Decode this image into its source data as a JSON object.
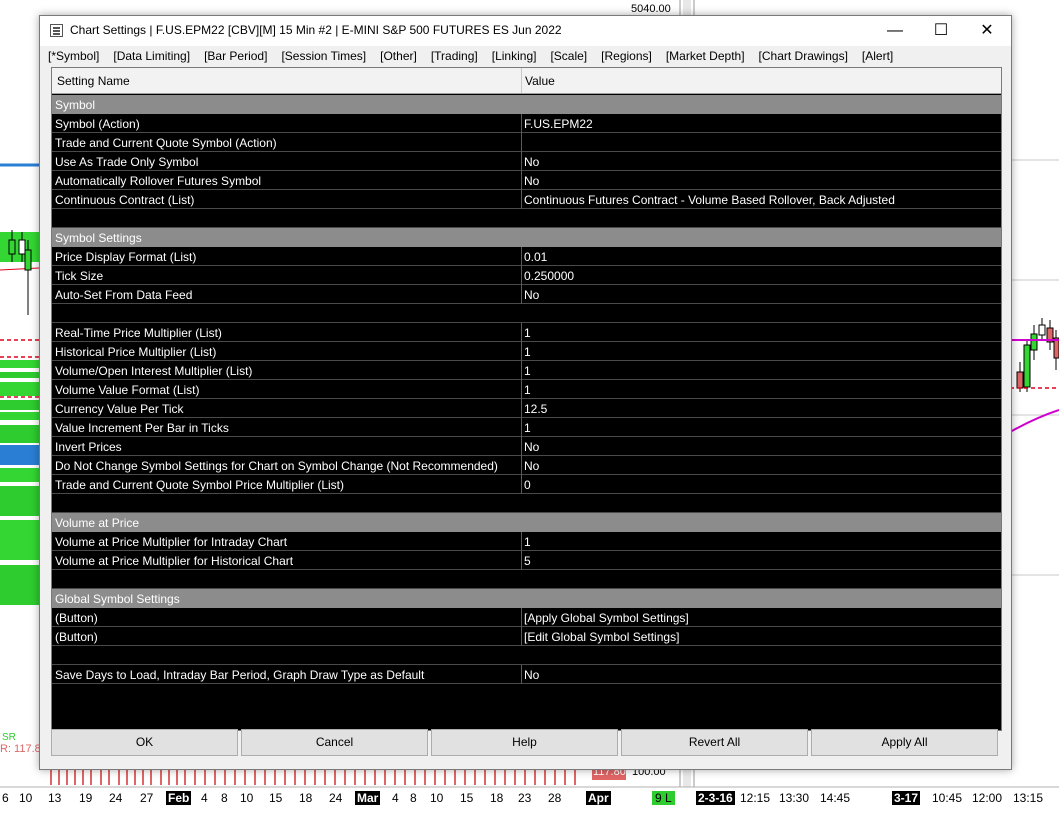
{
  "background": {
    "price_top": "5040.00",
    "price_bottom": "100.00",
    "price_red_tag": "117.80",
    "left_labels": [
      "SR",
      "R: 117.8"
    ],
    "timeline": [
      {
        "text": "6",
        "hl": false
      },
      {
        "text": "10",
        "hl": false
      },
      {
        "text": "13",
        "hl": false
      },
      {
        "text": "19",
        "hl": false
      },
      {
        "text": "24",
        "hl": false
      },
      {
        "text": "27",
        "hl": false
      },
      {
        "text": "Feb",
        "hl": true
      },
      {
        "text": "4",
        "hl": false
      },
      {
        "text": "8",
        "hl": false
      },
      {
        "text": "10",
        "hl": false
      },
      {
        "text": "15",
        "hl": false
      },
      {
        "text": "18",
        "hl": false
      },
      {
        "text": "24",
        "hl": false
      },
      {
        "text": "Mar",
        "hl": true
      },
      {
        "text": "4",
        "hl": false
      },
      {
        "text": "8",
        "hl": false
      },
      {
        "text": "10",
        "hl": false
      },
      {
        "text": "15",
        "hl": false
      },
      {
        "text": "18",
        "hl": false
      },
      {
        "text": "23",
        "hl": false
      },
      {
        "text": "28",
        "hl": false
      },
      {
        "text": "Apr",
        "hl": true
      },
      {
        "text": "9 L",
        "hl": "grn"
      },
      {
        "text": "2-3-16",
        "hl": true
      },
      {
        "text": "12:15",
        "hl": false
      },
      {
        "text": "13:30",
        "hl": false
      },
      {
        "text": "14:45",
        "hl": false
      },
      {
        "text": "3-17",
        "hl": true
      },
      {
        "text": "10:45",
        "hl": false
      },
      {
        "text": "12:00",
        "hl": false
      },
      {
        "text": "13:15",
        "hl": false
      }
    ],
    "colors": {
      "green_bar": "#33d633",
      "red_line": "#e0001b",
      "magenta": "#d000d0",
      "blue": "#2a7fd4"
    }
  },
  "window": {
    "title": "Chart Settings | F.US.EPM22 [CBV][M]  15 Min   #2 | E-MINI S&P 500 FUTURES ES Jun 2022",
    "minimize_icon": "—",
    "maximize_icon": "☐",
    "close_icon": "✕"
  },
  "menu": [
    "[*Symbol]",
    "[Data Limiting]",
    "[Bar Period]",
    "[Session Times]",
    "[Other]",
    "[Trading]",
    "[Linking]",
    "[Scale]",
    "[Regions]",
    "[Market Depth]",
    "[Chart Drawings]",
    "[Alert]"
  ],
  "grid": {
    "header": {
      "name": "Setting Name",
      "value": "Value"
    },
    "rows": [
      {
        "type": "section",
        "name": "Symbol",
        "value": ""
      },
      {
        "type": "row",
        "name": "Symbol (Action)",
        "value": "F.US.EPM22"
      },
      {
        "type": "row",
        "name": "Trade and Current Quote Symbol (Action)",
        "value": ""
      },
      {
        "type": "row",
        "name": "Use As Trade Only Symbol",
        "value": "No"
      },
      {
        "type": "row",
        "name": "Automatically Rollover Futures Symbol",
        "value": "No"
      },
      {
        "type": "row",
        "name": "Continuous Contract (List)",
        "value": "Continuous Futures Contract - Volume Based Rollover, Back Adjusted"
      },
      {
        "type": "blank",
        "name": "",
        "value": ""
      },
      {
        "type": "section",
        "name": "Symbol Settings",
        "value": ""
      },
      {
        "type": "row",
        "name": "Price Display Format (List)",
        "value": "0.01"
      },
      {
        "type": "row",
        "name": "Tick Size",
        "value": "0.250000"
      },
      {
        "type": "row",
        "name": "Auto-Set From Data Feed",
        "value": "No"
      },
      {
        "type": "blank",
        "name": "",
        "value": ""
      },
      {
        "type": "row",
        "name": "Real-Time Price Multiplier (List)",
        "value": "1"
      },
      {
        "type": "row",
        "name": "Historical Price Multiplier (List)",
        "value": "1"
      },
      {
        "type": "row",
        "name": "Volume/Open Interest Multiplier (List)",
        "value": "1"
      },
      {
        "type": "row",
        "name": "Volume Value Format (List)",
        "value": "1"
      },
      {
        "type": "row",
        "name": "Currency Value Per Tick",
        "value": "12.5"
      },
      {
        "type": "row",
        "name": "Value Increment Per Bar in Ticks",
        "value": "1"
      },
      {
        "type": "row",
        "name": "Invert Prices",
        "value": "No"
      },
      {
        "type": "row",
        "name": "Do Not Change Symbol Settings for Chart on Symbol Change (Not Recommended)",
        "value": "No"
      },
      {
        "type": "row",
        "name": "Trade and Current Quote Symbol Price Multiplier (List)",
        "value": "0"
      },
      {
        "type": "blank",
        "name": "",
        "value": ""
      },
      {
        "type": "section",
        "name": "Volume at Price",
        "value": ""
      },
      {
        "type": "row",
        "name": "Volume at Price Multiplier for Intraday Chart",
        "value": "1"
      },
      {
        "type": "row",
        "name": "Volume at Price Multiplier for Historical Chart",
        "value": "5"
      },
      {
        "type": "blank",
        "name": "",
        "value": ""
      },
      {
        "type": "section",
        "name": "Global Symbol Settings",
        "value": ""
      },
      {
        "type": "row",
        "name": " (Button)",
        "value": "[Apply Global Symbol Settings]"
      },
      {
        "type": "row",
        "name": " (Button)",
        "value": "[Edit Global Symbol Settings]"
      },
      {
        "type": "blank",
        "name": "",
        "value": ""
      },
      {
        "type": "row",
        "name": "Save Days to Load, Intraday Bar Period, Graph Draw Type as Default",
        "value": "No"
      }
    ]
  },
  "buttons": {
    "ok": "OK",
    "cancel": "Cancel",
    "help": "Help",
    "revert_all": "Revert All",
    "apply_all": "Apply All"
  }
}
